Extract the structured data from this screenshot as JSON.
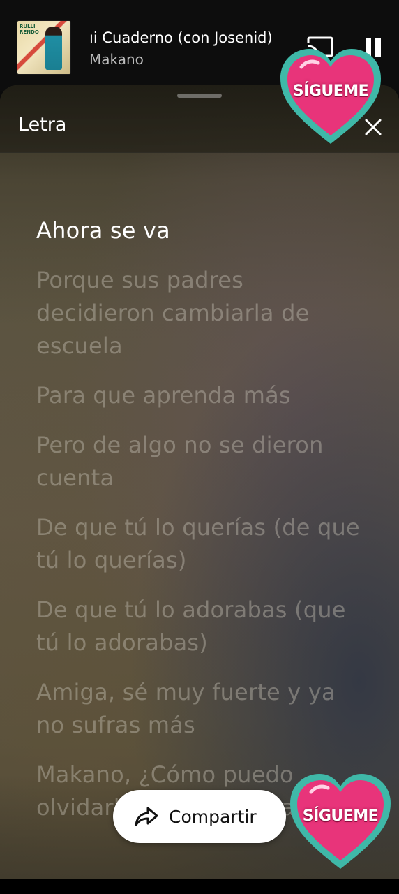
{
  "now_playing": {
    "title": "Mi Cuaderno (con Josenid)",
    "title_visible": "ıi Cuaderno (con Josenid)",
    "artist": "Makano",
    "album_art_text": "RULLI RENDO"
  },
  "controls": {
    "cast_icon": "cast-icon",
    "pause_icon": "pause-icon"
  },
  "sheet": {
    "title": "Letra",
    "close_icon": "close-icon"
  },
  "lyrics": [
    {
      "text": "Ahora se va",
      "active": true
    },
    {
      "text": "Porque sus padres decidieron cambiarla de escuela",
      "active": false
    },
    {
      "text": "Para que aprenda más",
      "active": false
    },
    {
      "text": "Pero de algo no se dieron cuenta",
      "active": false
    },
    {
      "text": "De que tú lo querías (de que tú lo querías)",
      "active": false
    },
    {
      "text": "De que tú lo adorabas (que tú lo adorabas)",
      "active": false
    },
    {
      "text": "Amiga, sé muy fuerte y ya no sufras más",
      "active": false
    },
    {
      "text": "Makano, ¿Cómo puedo olvidarlo si lo quiero tanto?",
      "active": false
    }
  ],
  "share": {
    "label": "Compartir",
    "icon": "share-icon"
  },
  "stickers": [
    {
      "label": "SÍGUEME",
      "color": "#e8347a",
      "outline": "#3fb8a8"
    },
    {
      "label": "SÍGUEME",
      "color": "#e8347a",
      "outline": "#3fb8a8"
    }
  ]
}
